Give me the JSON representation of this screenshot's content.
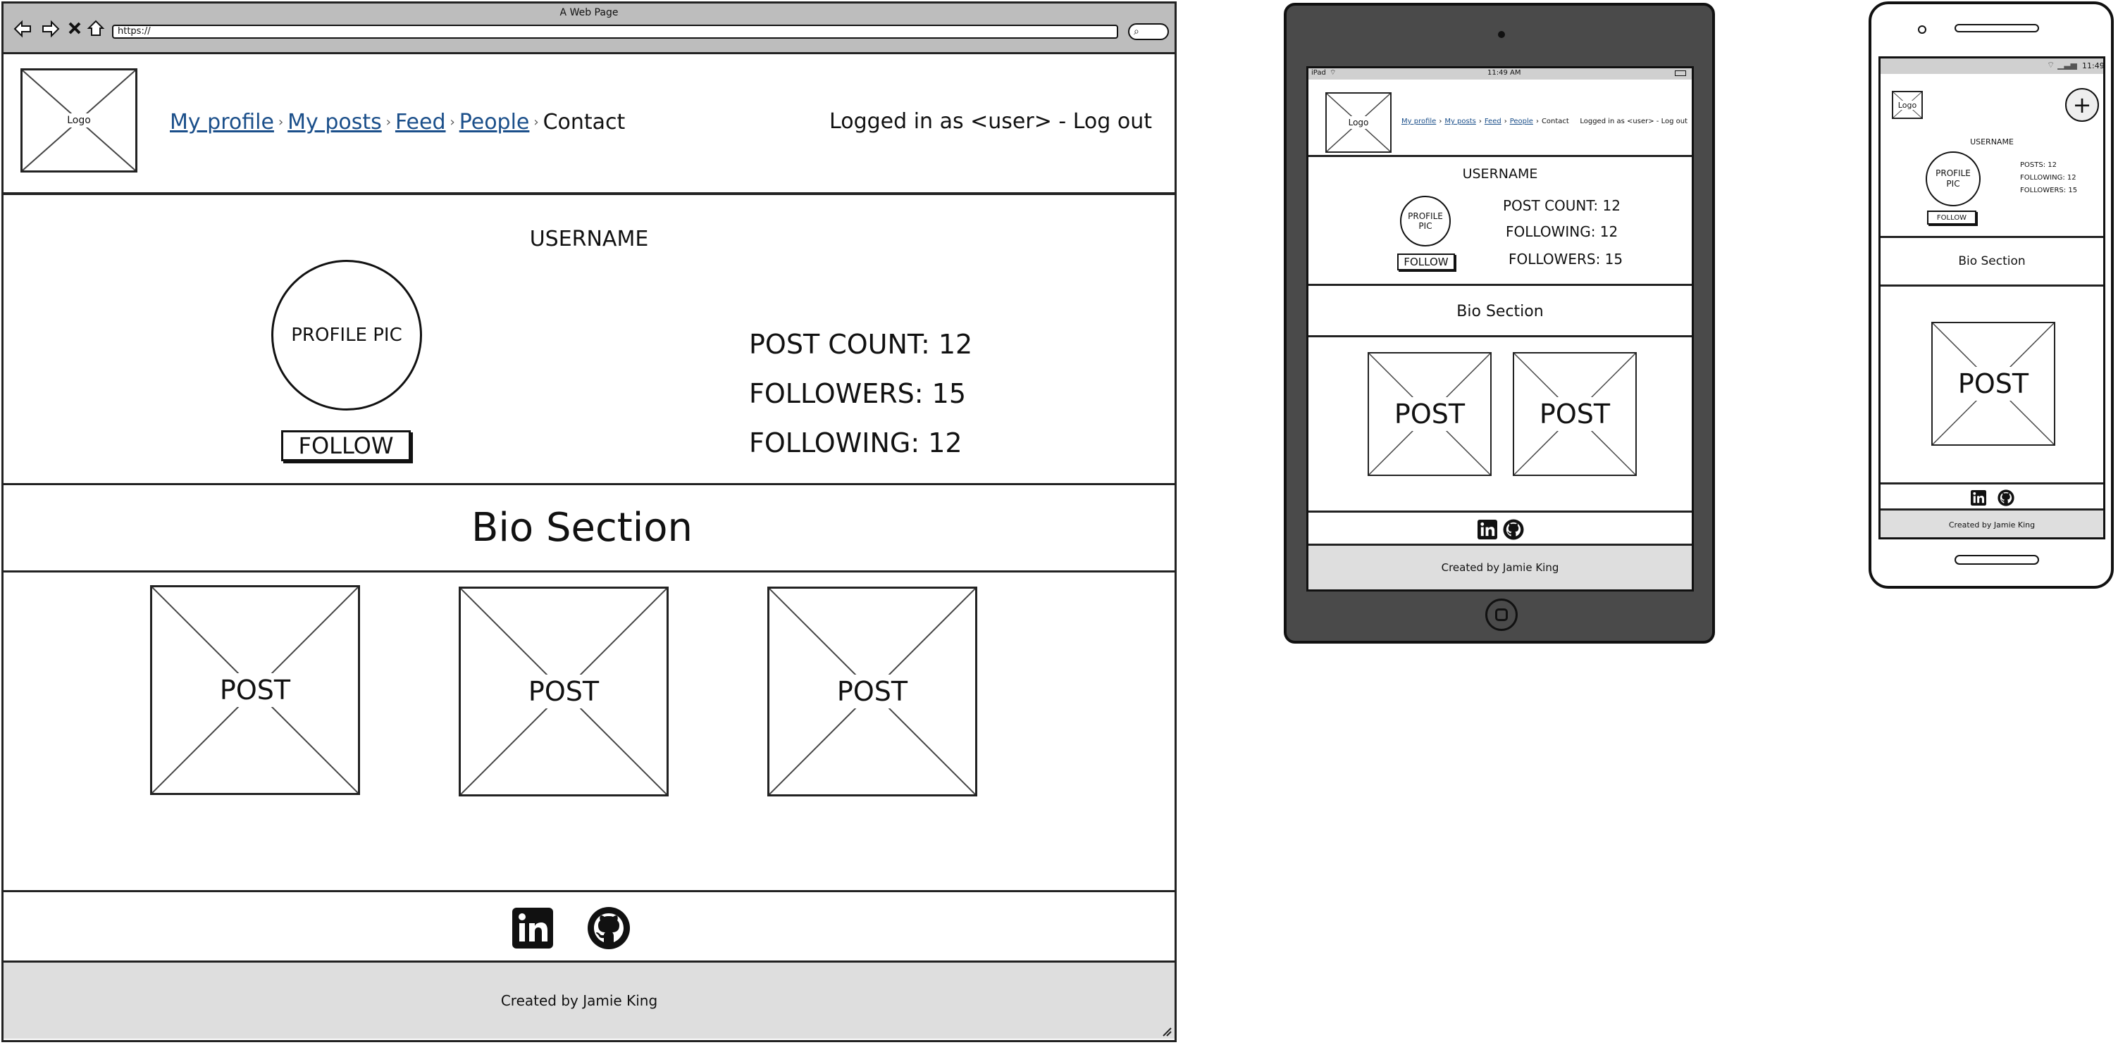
{
  "desktop": {
    "window_title": "A Web Page",
    "url": "https://",
    "nav": {
      "logo": "Logo",
      "links": [
        "My profile",
        "My posts",
        "Feed",
        "People"
      ],
      "current": "Contact",
      "user": "Logged in as <user> - Log out"
    },
    "profile": {
      "username": "USERNAME",
      "pic": "PROFILE PIC",
      "follow": "FOLLOW",
      "post_count": "POST COUNT: 12",
      "followers": "FOLLOWERS: 15",
      "following": "FOLLOWING: 12"
    },
    "bio": "Bio Section",
    "posts": [
      "POST",
      "POST",
      "POST"
    ],
    "footer": {
      "created": "Created by Jamie King",
      "icons": [
        "linkedin-icon",
        "github-icon"
      ]
    }
  },
  "ipad": {
    "status_left": "iPad",
    "status_time": "11:49 AM",
    "nav": {
      "logo": "Logo",
      "links": [
        "My profile",
        "My posts",
        "Feed",
        "People"
      ],
      "current": "Contact",
      "user": "Logged in as <user> - Log out"
    },
    "profile": {
      "username": "USERNAME",
      "pic": "PROFILE PIC",
      "follow": "FOLLOW",
      "post_count": "POST COUNT: 12",
      "following": "FOLLOWING: 12",
      "followers": "FOLLOWERS: 15"
    },
    "bio": "Bio Section",
    "posts": [
      "POST",
      "POST"
    ],
    "footer": {
      "created": "Created by Jamie King"
    }
  },
  "phone": {
    "status_time": "11:49",
    "logo": "Logo",
    "profile": {
      "username": "USERNAME",
      "pic": "PROFILE PIC",
      "follow": "FOLLOW",
      "posts": "POSTS: 12",
      "following": "FOLLOWING: 12",
      "followers": "FOLLOWERS: 15"
    },
    "bio": "Bio Section",
    "post": "POST",
    "footer": {
      "created": "Created by Jamie King"
    }
  },
  "colors": {
    "link": "#1b4f8a",
    "footer_bg": "#dedede",
    "chrome_bg": "#bdbdbd",
    "ipad_shell": "#4a4a4a"
  }
}
